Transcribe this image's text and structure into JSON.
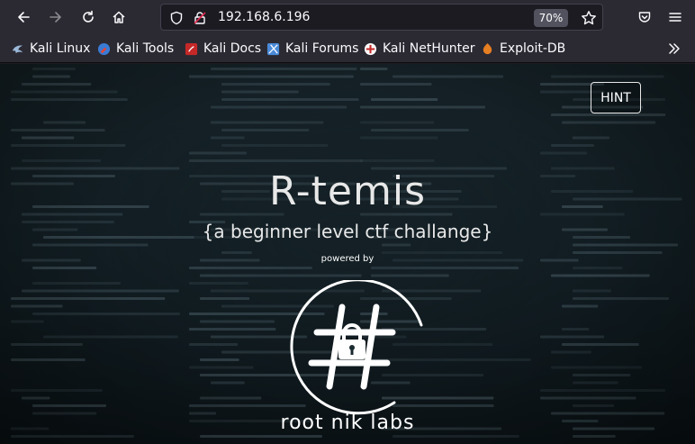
{
  "browser": {
    "url": "192.168.6.196",
    "zoom": "70%"
  },
  "bookmarks": [
    {
      "label": "Kali Linux",
      "color": "#3a7bd5"
    },
    {
      "label": "Kali Tools",
      "color": "#e0463a"
    },
    {
      "label": "Kali Docs",
      "color": "#c62828"
    },
    {
      "label": "Kali Forums",
      "color": "#4a8ad8"
    },
    {
      "label": "Kali NetHunter",
      "color": "#c62828"
    },
    {
      "label": "Exploit-DB",
      "color": "#e67e22"
    }
  ],
  "page": {
    "hint_label": "HINT",
    "title": "R-temis",
    "subtitle": "{a beginner level ctf challange}",
    "powered_by": "powered by",
    "logo_text": "root nik labs"
  }
}
